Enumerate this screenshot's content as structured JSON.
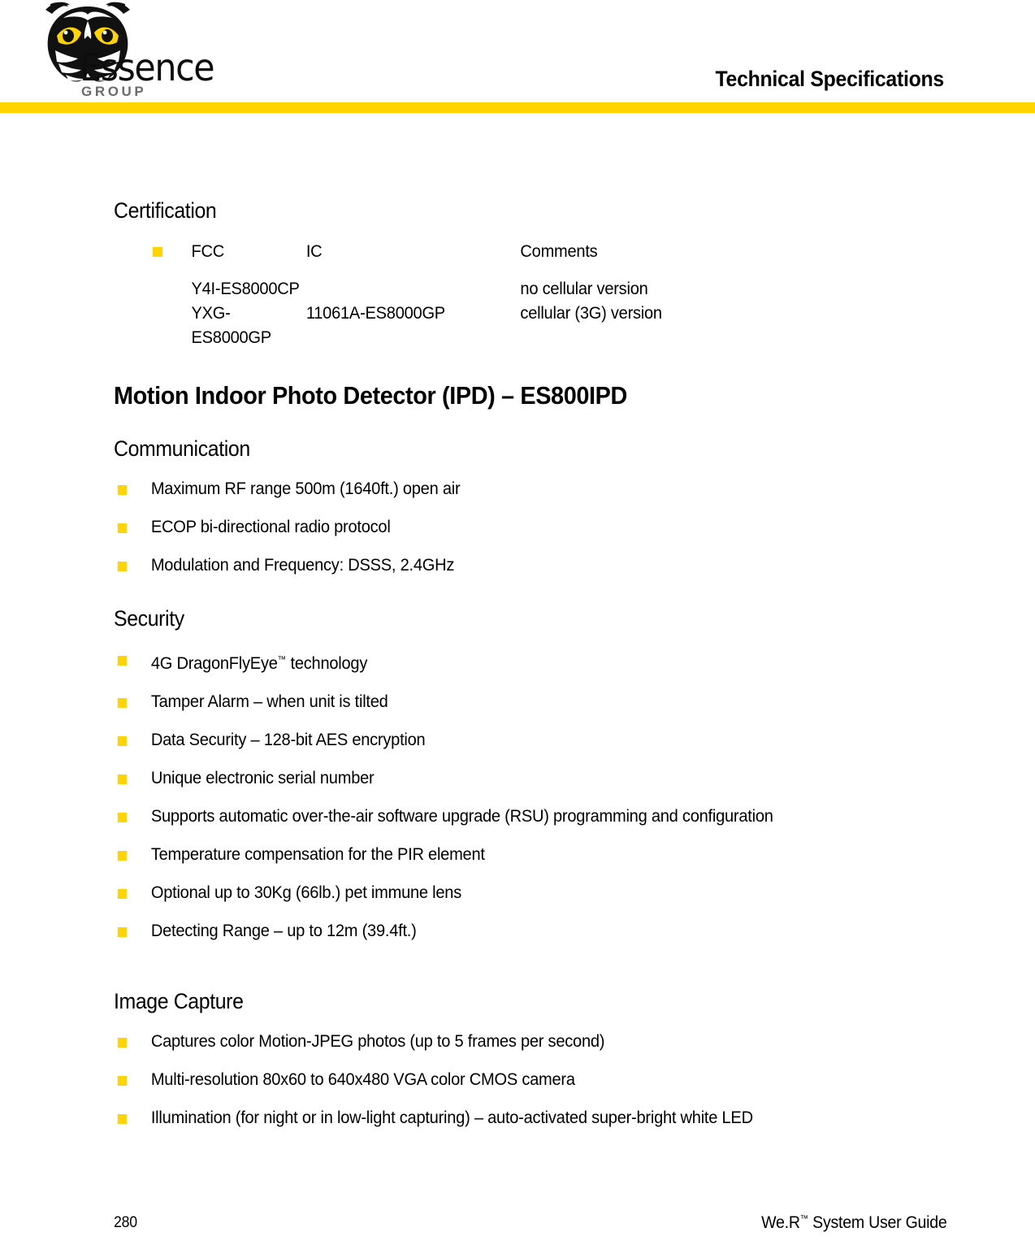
{
  "brand": {
    "name": "Essence",
    "sub": "GROUP",
    "logo_icon": "owl-head-icon",
    "eye_color": "#FFD400",
    "accent_color": "#FFD400"
  },
  "header": {
    "title": "Technical Specifications"
  },
  "certification": {
    "heading": "Certification",
    "columns": [
      "FCC",
      "IC",
      "Comments"
    ],
    "rows": [
      {
        "fcc": "Y4I-ES8000CP",
        "ic": "",
        "comments": "no cellular version"
      },
      {
        "fcc": "YXG-ES8000GP",
        "ic": "11061A-ES8000GP",
        "comments": "cellular (3G) version"
      }
    ]
  },
  "product": {
    "title": "Motion Indoor Photo Detector (IPD) – ES800IPD"
  },
  "communication": {
    "heading": "Communication",
    "items": [
      "Maximum RF range 500m (1640ft.) open air",
      "ECOP bi-directional radio protocol",
      "Modulation and Frequency: DSSS, 2.4GHz"
    ]
  },
  "security": {
    "heading": "Security",
    "items": [
      "4G DragonFlyEye™ technology",
      "Tamper Alarm – when unit is tilted",
      "Data Security – 128-bit AES encryption",
      "Unique electronic serial number",
      "Supports automatic over-the-air software upgrade (RSU) programming and configuration",
      "Temperature compensation for the PIR element",
      "Optional up to 30Kg (66lb.) pet immune lens",
      "Detecting Range – up to 12m (39.4ft.)"
    ]
  },
  "image_capture": {
    "heading": "Image Capture",
    "items": [
      "Captures color Motion-JPEG photos (up to 5 frames per second)",
      "Multi-resolution 80x60 to 640x480 VGA color CMOS camera",
      "Illumination (for night or in low-light capturing) – auto-activated super-bright white LED"
    ]
  },
  "footer": {
    "page_number": "280",
    "guide": "We.R™ System User Guide"
  }
}
